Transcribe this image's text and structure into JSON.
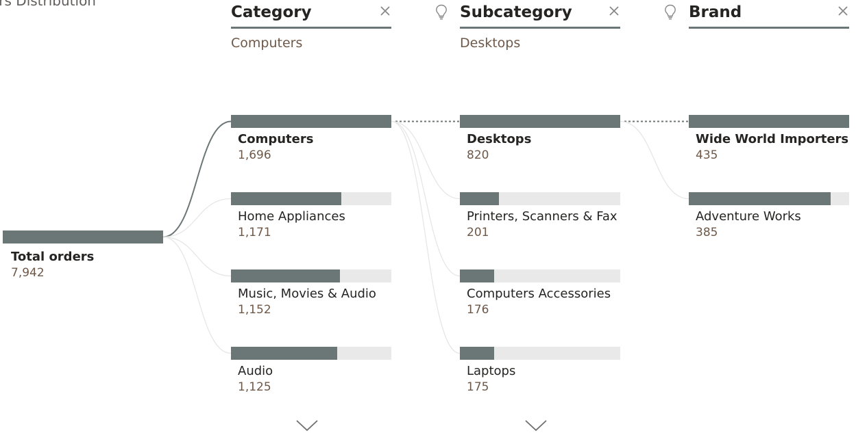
{
  "title": "ers Distribution",
  "root": {
    "label": "Total orders",
    "value": "7,942",
    "fraction": 1.0
  },
  "columns": [
    {
      "header": "Category",
      "filter": "Computers",
      "has_bulb": false,
      "has_more": true,
      "nodes": [
        {
          "label": "Computers",
          "value": "1,696",
          "fraction": 1.0,
          "selected": true
        },
        {
          "label": "Home Appliances",
          "value": "1,171",
          "fraction": 0.69,
          "selected": false
        },
        {
          "label": "Music, Movies & Audio",
          "value": "1,152",
          "fraction": 0.679,
          "selected": false
        },
        {
          "label": "Audio",
          "value": "1,125",
          "fraction": 0.663,
          "selected": false
        }
      ]
    },
    {
      "header": "Subcategory",
      "filter": "Desktops",
      "has_bulb": true,
      "has_more": true,
      "nodes": [
        {
          "label": "Desktops",
          "value": "820",
          "fraction": 1.0,
          "selected": true
        },
        {
          "label": "Printers, Scanners & Fax",
          "value": "201",
          "fraction": 0.245,
          "selected": false
        },
        {
          "label": "Computers Accessories",
          "value": "176",
          "fraction": 0.215,
          "selected": false
        },
        {
          "label": "Laptops",
          "value": "175",
          "fraction": 0.213,
          "selected": false
        }
      ]
    },
    {
      "header": "Brand",
      "filter": "",
      "has_bulb": true,
      "has_more": false,
      "nodes": [
        {
          "label": "Wide World Importers",
          "value": "435",
          "fraction": 1.0,
          "selected": true
        },
        {
          "label": "Adventure Works",
          "value": "385",
          "fraction": 0.885,
          "selected": false
        }
      ]
    }
  ],
  "icons": {
    "close": "close-icon",
    "bulb": "lightbulb-icon",
    "more": "chevron-down-icon"
  },
  "colors": {
    "bar": "#6b7677",
    "track": "#e9e9e9",
    "value_text": "#6e5848",
    "selected_connector": "#6b7677",
    "connector": "#e6e6e6"
  }
}
